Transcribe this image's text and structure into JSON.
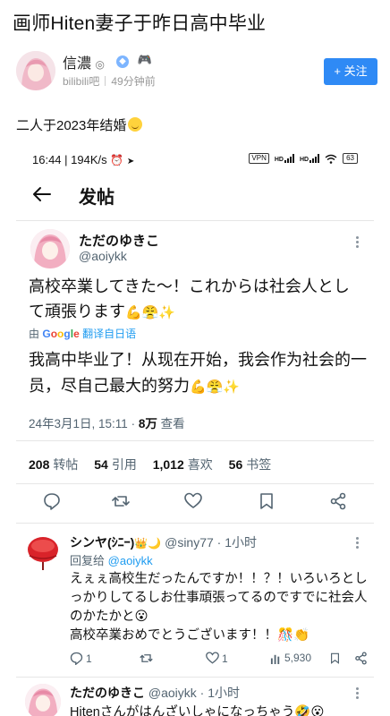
{
  "post": {
    "title": "画师Hiten妻子于昨日高中毕业",
    "author": {
      "name": "信濃",
      "name_mark": "◎",
      "source": "bilibili吧",
      "time": "49分钟前"
    },
    "follow_label": "+ 关注",
    "body": "二人于2023年结婚"
  },
  "screenshot": {
    "status": {
      "time_speed": "16:44 | 194K/s",
      "vpn": "VPN",
      "hd": "HD",
      "battery": "63"
    },
    "header_title": "发帖",
    "tweet": {
      "name": "ただのゆきこ",
      "handle": "@aoiykk",
      "text": "高校卒業してきた〜！これからは社会人として頑張ります",
      "text_emojis": "💪😤✨",
      "translate_by": "由",
      "google": [
        "G",
        "o",
        "o",
        "g",
        "l",
        "e"
      ],
      "translate_link": "翻译自日语",
      "translated_text": "我高中毕业了！从现在开始，我会作为社会的一员，尽自己最大的努力",
      "translated_emojis": "💪😤✨",
      "time": "24年3月1日, 15:11 ·",
      "views": "8万",
      "views_label": "查看"
    },
    "stats": {
      "reposts": "208",
      "reposts_label": "转帖",
      "quotes": "54",
      "quotes_label": "引用",
      "likes": "1,012",
      "likes_label": "喜欢",
      "bookmarks": "56",
      "bookmarks_label": "书签"
    },
    "reply1": {
      "name": "シンヤ(ｼﾆｰ)",
      "name_emojis": "👑🌙",
      "handle": "@siny77 · 1小时",
      "replying_label": "回复给",
      "replying_to": "@aoiykk",
      "text": "えぇぇ高校生だったんですか！！？！いろいろとしっかりしてるしお仕事頑張ってるのですでに社会人のかたかと😮",
      "text2": "高校卒業おめでとうございます！！",
      "text2_emojis": "🎊👏",
      "replies": "1",
      "likes": "1",
      "views": "5,930"
    },
    "reply2": {
      "name": "ただのゆきこ",
      "handle": "@aoiykk · 1小时",
      "text": "Hitenさんがはんざいしゃになっちゃう🤣😮"
    }
  }
}
